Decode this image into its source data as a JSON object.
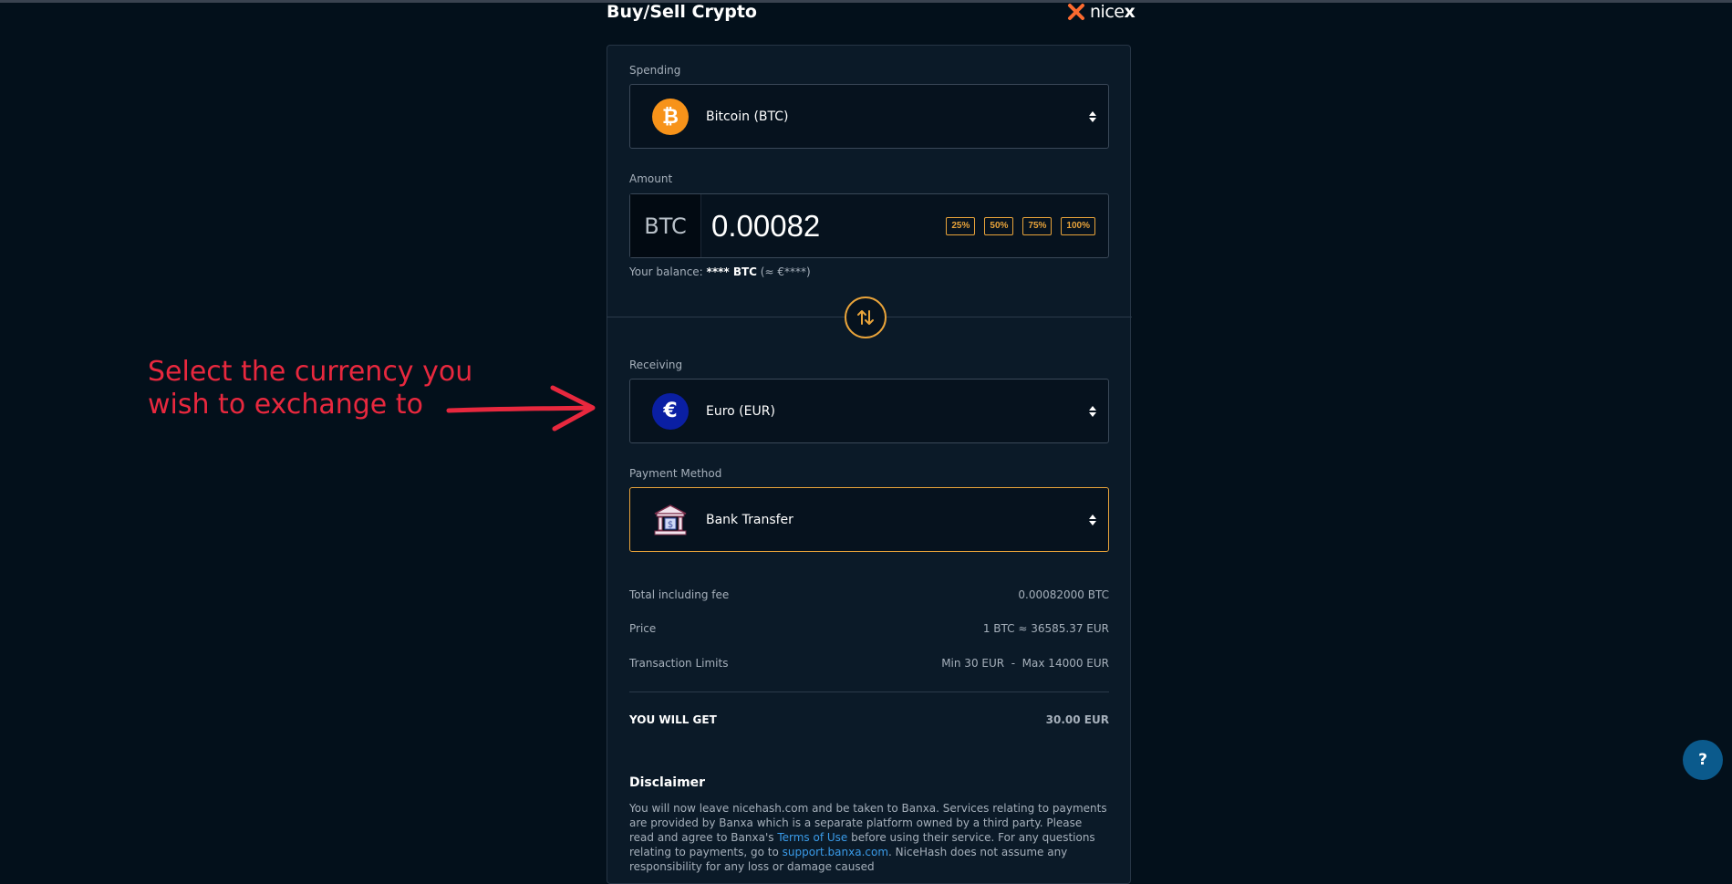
{
  "page": {
    "title": "Buy/Sell Crypto",
    "brand_prefix": "nice",
    "brand_suffix": "x"
  },
  "spending": {
    "label": "Spending",
    "selected": "Bitcoin (BTC)",
    "icon": "bitcoin-icon"
  },
  "amount": {
    "label": "Amount",
    "currency": "BTC",
    "value": "0.00082",
    "quick_buttons": [
      "25%",
      "50%",
      "75%",
      "100%"
    ]
  },
  "balance": {
    "prefix": "Your balance:",
    "masked": "**** BTC",
    "approx": "(≈ €****)"
  },
  "receiving": {
    "label": "Receiving",
    "selected": "Euro (EUR)",
    "icon": "euro-icon"
  },
  "payment": {
    "label": "Payment Method",
    "selected": "Bank Transfer",
    "icon": "bank-icon"
  },
  "summary": {
    "total_label": "Total including fee",
    "total_value": "0.00082000 BTC",
    "price_label": "Price",
    "price_value": "1 BTC ≈ 36585.37 EUR",
    "limits_label": "Transaction Limits",
    "limits_value": "Min 30 EUR  -  Max 14000 EUR",
    "get_label": "YOU WILL GET",
    "get_value": "30.00 EUR"
  },
  "disclaimer": {
    "title": "Disclaimer",
    "text1": "You will now leave nicehash.com and be taken to Banxa. Services relating to payments are provided by Banxa which is a separate platform owned by a third party. Please read and agree to Banxa's ",
    "link1": "Terms of Use",
    "text2": " before using their service. For any questions relating to payments, go to ",
    "link2": "support.banxa.com",
    "text3": ". NiceHash does not assume any responsibility for any loss or damage caused"
  },
  "annotation": {
    "line1": "Select the currency you",
    "line2": "wish to exchange to"
  },
  "help_label": "?",
  "colors": {
    "background": "#03101b",
    "card": "#0b1a28",
    "accent": "#e8a33a",
    "annotation": "#e8283e",
    "link": "#3a9be8",
    "bitcoin": "#f7931a",
    "euro": "#0a1fa3"
  }
}
